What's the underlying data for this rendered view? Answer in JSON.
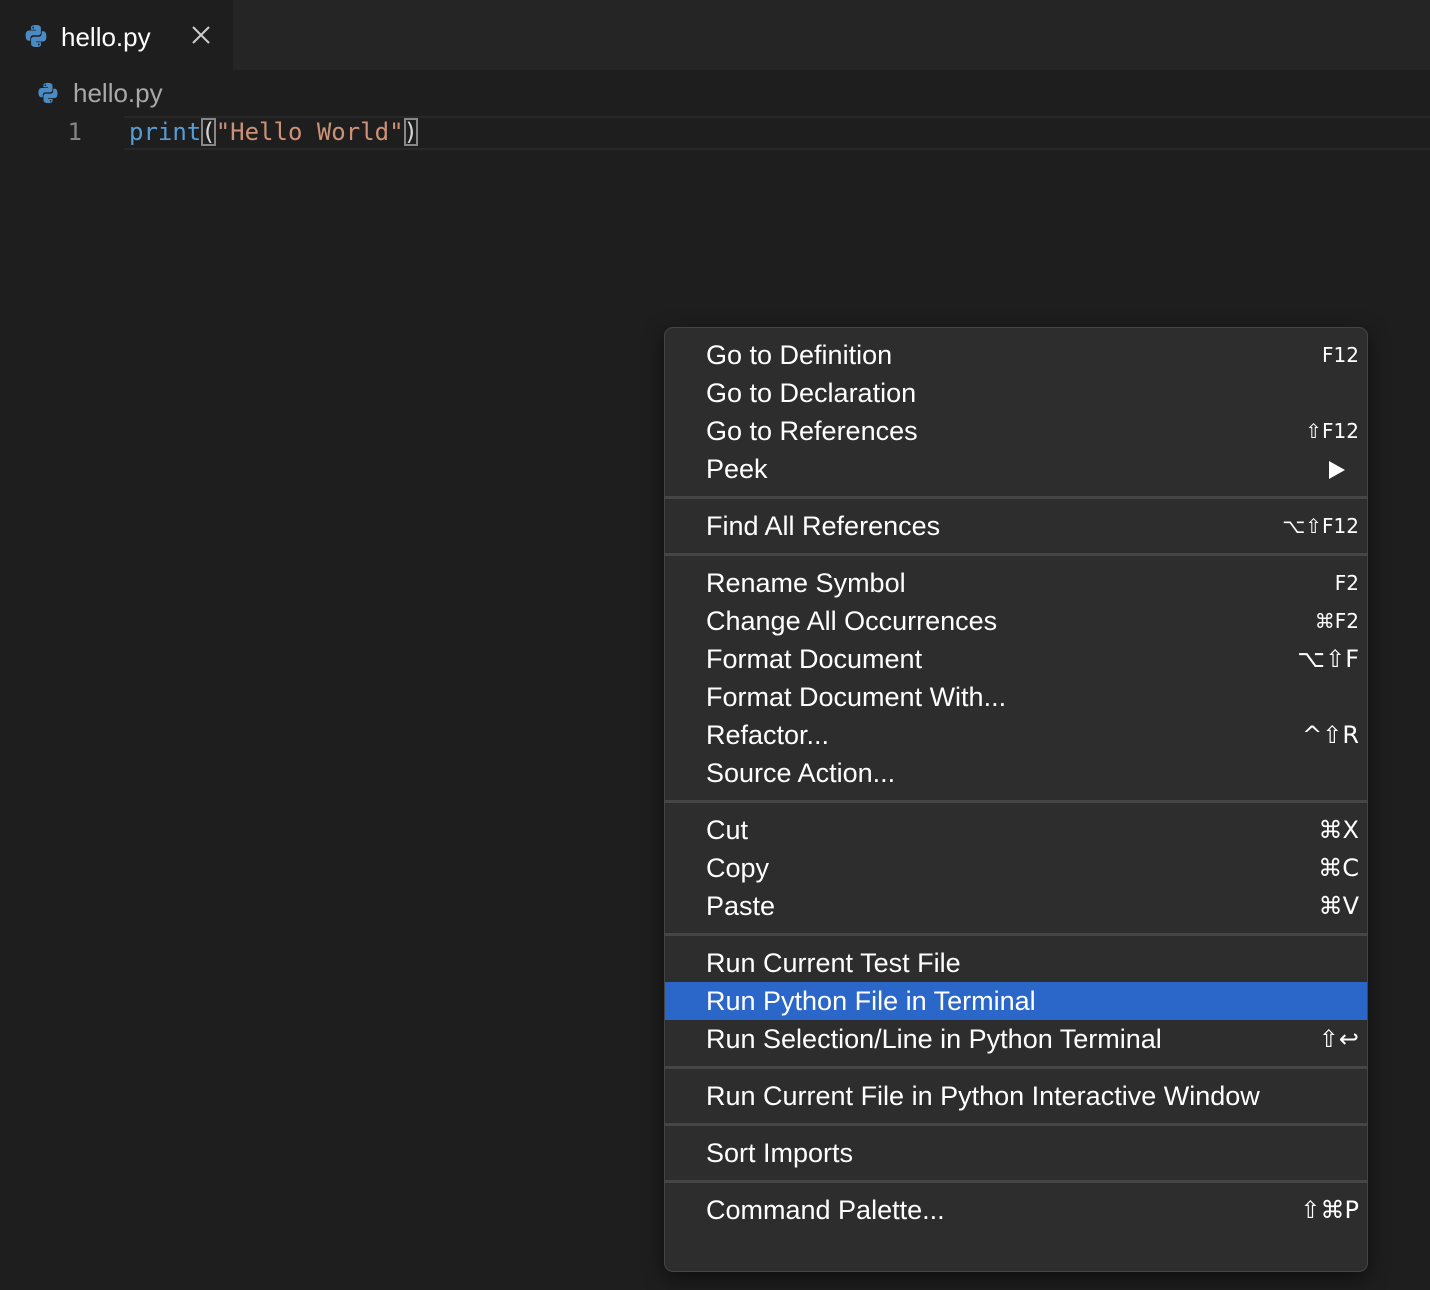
{
  "tab": {
    "title": "hello.py",
    "icon": "python-icon",
    "close_icon": "close-icon"
  },
  "breadcrumb": {
    "file": "hello.py",
    "icon": "python-icon"
  },
  "editor": {
    "line_number": "1",
    "code": {
      "func": "print",
      "open_paren": "(",
      "string": "\"Hello World\"",
      "close_paren": ")"
    }
  },
  "context_menu": {
    "groups": [
      [
        {
          "label": "Go to Definition",
          "shortcut": "F12"
        },
        {
          "label": "Go to Declaration",
          "shortcut": ""
        },
        {
          "label": "Go to References",
          "shortcut": "⇧F12"
        },
        {
          "label": "Peek",
          "submenu": true
        }
      ],
      [
        {
          "label": "Find All References",
          "shortcut": "⌥⇧F12"
        }
      ],
      [
        {
          "label": "Rename Symbol",
          "shortcut": "F2"
        },
        {
          "label": "Change All Occurrences",
          "shortcut": "⌘F2"
        },
        {
          "label": "Format Document",
          "shortcut": "⌥⇧F"
        },
        {
          "label": "Format Document With...",
          "shortcut": ""
        },
        {
          "label": "Refactor...",
          "shortcut": "^⇧R"
        },
        {
          "label": "Source Action...",
          "shortcut": ""
        }
      ],
      [
        {
          "label": "Cut",
          "shortcut": "⌘X"
        },
        {
          "label": "Copy",
          "shortcut": "⌘C"
        },
        {
          "label": "Paste",
          "shortcut": "⌘V"
        }
      ],
      [
        {
          "label": "Run Current Test File",
          "shortcut": ""
        },
        {
          "label": "Run Python File in Terminal",
          "shortcut": "",
          "active": true
        },
        {
          "label": "Run Selection/Line in Python Terminal",
          "shortcut": "⇧↩"
        }
      ],
      [
        {
          "label": "Run Current File in Python Interactive Window",
          "shortcut": ""
        }
      ],
      [
        {
          "label": "Sort Imports",
          "shortcut": ""
        }
      ],
      [
        {
          "label": "Command Palette...",
          "shortcut": "⇧⌘P"
        }
      ]
    ],
    "active_color": "#2b66c9"
  },
  "colors": {
    "editor_bg": "#1e1e1e",
    "tab_bar_bg": "#252526",
    "menu_bg": "#2d2d2d",
    "keyword": "#569cd6",
    "string": "#ce9178",
    "python_blue": "#4a8bc4"
  }
}
